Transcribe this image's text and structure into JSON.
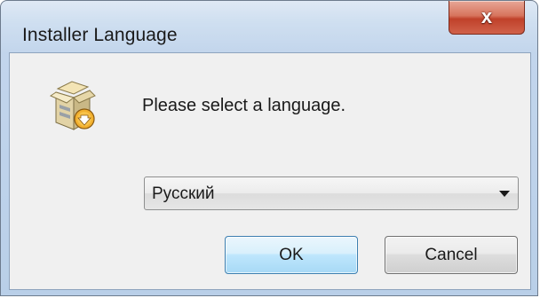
{
  "window": {
    "title": "Installer Language",
    "close_label": "x"
  },
  "dialog": {
    "icon": "installer-box-icon",
    "prompt": "Please select a language.",
    "language_select": {
      "selected": "Русский"
    },
    "buttons": {
      "ok_label": "OK",
      "cancel_label": "Cancel"
    }
  },
  "colors": {
    "titlebar": "#c2d5ec",
    "client_bg": "#f0f0f0",
    "close_button": "#c0412a",
    "default_button_border": "#3c7fb1"
  }
}
